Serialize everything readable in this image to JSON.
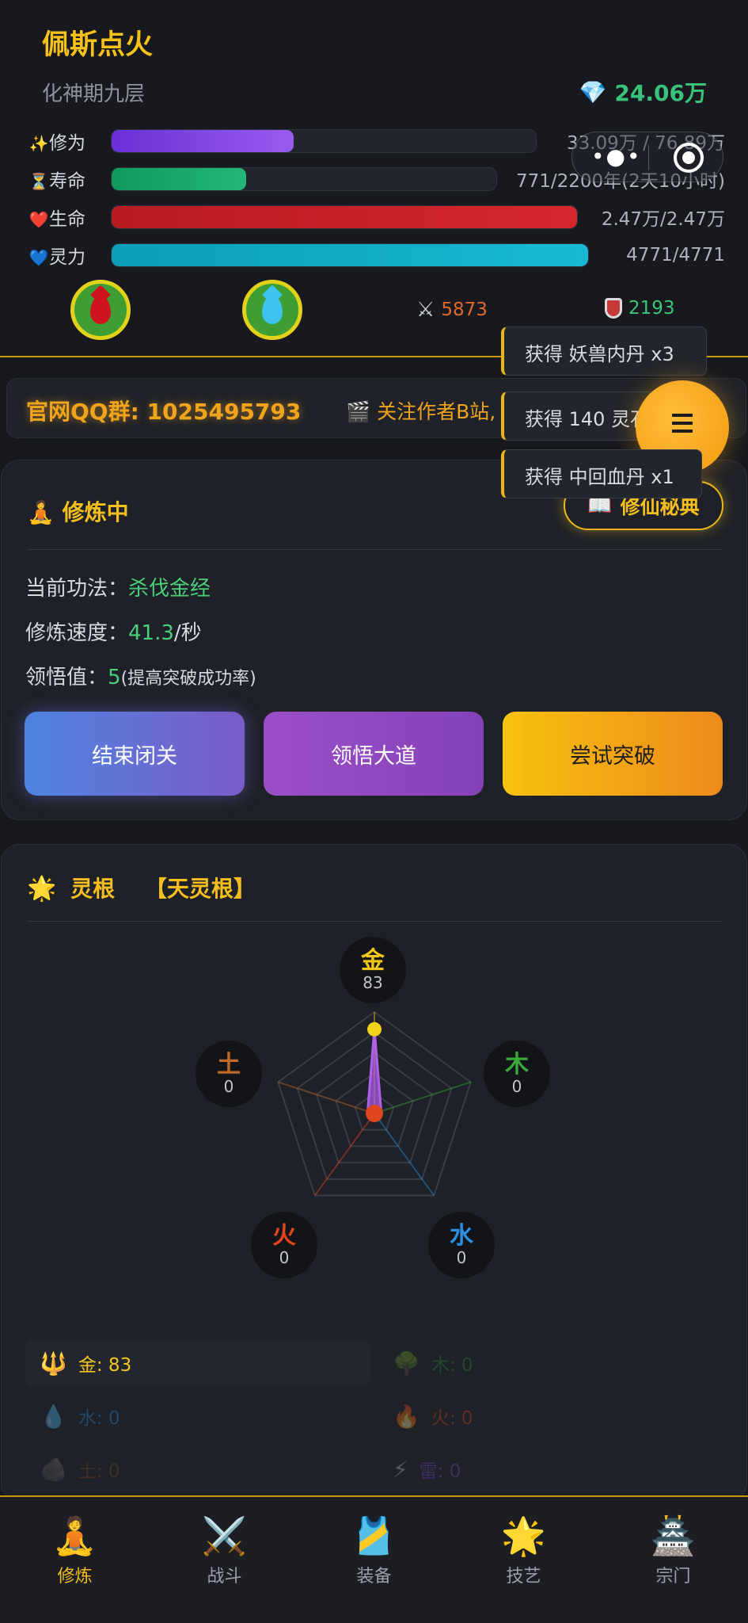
{
  "header": {
    "player_name": "佩斯点火",
    "realm": "化神期九层",
    "spirit_stones": "24.06万",
    "stone_icon": "diamond-icon"
  },
  "stats": [
    {
      "icon": "✨",
      "label": "修为",
      "value": "33.09万 / 76.89万",
      "progress": 0.43,
      "color": "#7a3fe0"
    },
    {
      "icon": "⏳",
      "label": "寿命",
      "value": "771/2200年(2天10小时)",
      "progress": 0.35,
      "color": "#18a56a"
    },
    {
      "icon": "❤️",
      "label": "生命",
      "value": "2.47万/2.47万",
      "progress": 1.0,
      "color": "#d0232a"
    },
    {
      "icon": "💙",
      "label": "灵力",
      "value": "4771/4771",
      "progress": 1.0,
      "color": "#13aec9"
    }
  ],
  "combat": {
    "attack_icon": "crossed-swords-icon",
    "attack": "5873",
    "attack_color": "#e06a2b",
    "defense_icon": "shield-icon",
    "defense": "2193",
    "defense_color": "#3cc47a"
  },
  "notice": {
    "qq_group": "官网QQ群: 1025495793",
    "bilibili": "🎬 关注作者B站,"
  },
  "toasts": [
    "获得 妖兽内丹 x3",
    "获得 140 灵石",
    "获得 中回血丹 x1"
  ],
  "cultivation": {
    "title": "修炼中",
    "title_icon": "🧘",
    "secret_button": "修仙秘典",
    "secret_icon": "📖",
    "method_label": "当前功法：",
    "method_value": "杀伐金经",
    "speed_label": "修炼速度：",
    "speed_value": "41.3",
    "speed_unit": "/秒",
    "insight_label": "领悟值：",
    "insight_value": "5",
    "insight_note": "(提高突破成功率)",
    "buttons": [
      "结束闭关",
      "领悟大道",
      "尝试突破"
    ]
  },
  "spirit_root": {
    "title": "灵根",
    "title_icon": "🌟",
    "type": "【天灵根】",
    "elements": [
      {
        "char": "金",
        "value": "83",
        "color": "#f2c61b"
      },
      {
        "char": "木",
        "value": "0",
        "color": "#3aa83a"
      },
      {
        "char": "水",
        "value": "0",
        "color": "#2b8fe0"
      },
      {
        "char": "火",
        "value": "0",
        "color": "#e0451f"
      },
      {
        "char": "土",
        "value": "0",
        "color": "#c06a28"
      }
    ],
    "radar": {
      "max": 100,
      "values": [
        83,
        0,
        0,
        0,
        0
      ]
    },
    "list": [
      {
        "icon": "🔱",
        "label": "金: 83",
        "color": "#f2c61b"
      },
      {
        "icon": "🌳",
        "label": "木: 0",
        "color": "#3aa83a"
      },
      {
        "icon": "💧",
        "label": "水: 0",
        "color": "#2b8fe0"
      },
      {
        "icon": "🔥",
        "label": "火: 0",
        "color": "#e0451f"
      },
      {
        "icon": "🪨",
        "label": "土: 0",
        "color": "#c06a28"
      },
      {
        "icon": "⚡",
        "label": "雷: 0",
        "color": "#8a4fe0"
      }
    ]
  },
  "tabs": [
    {
      "icon": "🧘",
      "label": "修炼"
    },
    {
      "icon": "⚔️",
      "label": "战斗"
    },
    {
      "icon": "🎽",
      "label": "装备"
    },
    {
      "icon": "🌟",
      "label": "技艺"
    },
    {
      "icon": "🏯",
      "label": "宗门"
    }
  ]
}
